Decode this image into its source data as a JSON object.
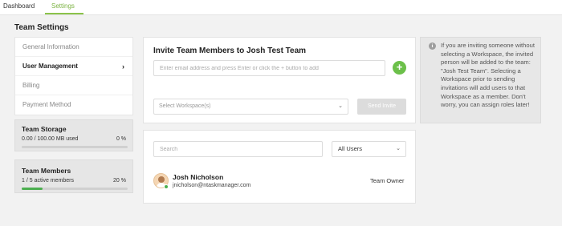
{
  "tabs": [
    {
      "label": "Dashboard",
      "active": false
    },
    {
      "label": "Settings",
      "active": true
    }
  ],
  "page_title": "Team Settings",
  "sidebar": {
    "items": [
      {
        "label": "General Information"
      },
      {
        "label": "User Management",
        "active": true
      },
      {
        "label": "Billing"
      },
      {
        "label": "Payment Method"
      }
    ],
    "chevron_icon": "chevron-right-icon"
  },
  "storage": {
    "title": "Team Storage",
    "usage": "0.00 / 100.00 MB used",
    "percent_text": "0 %",
    "fraction": 0
  },
  "members_stat": {
    "title": "Team Members",
    "usage": "1 / 5 active members",
    "percent_text": "20 %",
    "fraction": 0.2
  },
  "invite": {
    "title": "Invite Team Members to Josh Test Team",
    "email_placeholder": "Enter email address and press Enter or click the + button to add",
    "add_button": "+",
    "workspace_placeholder": "Select Workspace(s)",
    "send_button": "Send Invite"
  },
  "members": {
    "search_placeholder": "Search",
    "filter_value": "All Users",
    "list": [
      {
        "name": "Josh Nicholson",
        "email": "jnicholson@ntaskmanager.com",
        "role": "Team Owner",
        "status": "online"
      }
    ]
  },
  "info": {
    "icon": "info-icon",
    "icon_glyph": "i",
    "text": "If you are inviting someone without selecting a Workspace, the invited person will be added to the team: \"Josh Test Team\". Selecting a Workspace prior to sending invitations will add users to that Workspace as a member. Don't worry, you can assign roles later!"
  },
  "colors": {
    "accent": "#8bc34a",
    "progress": "#4caf50",
    "add_button": "#6cc04a",
    "background": "#f2f2f2"
  }
}
